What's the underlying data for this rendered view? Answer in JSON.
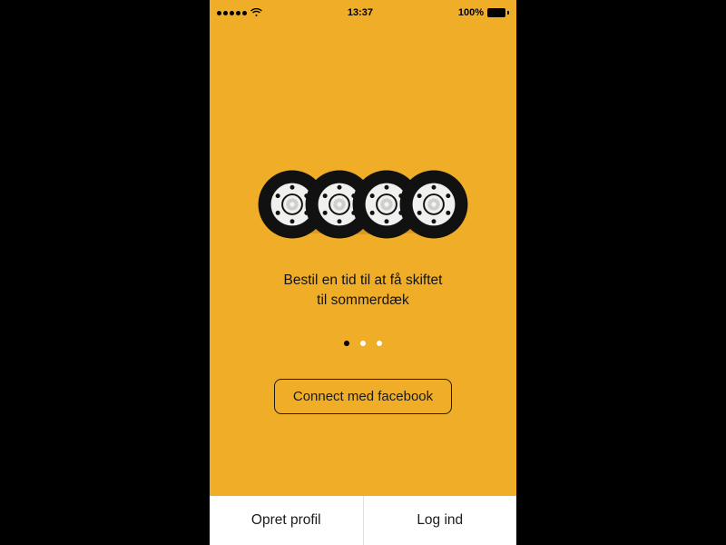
{
  "status": {
    "time": "13:37",
    "battery_text": "100%"
  },
  "onboarding": {
    "caption_line1": "Bestil en tid til at få skiftet",
    "caption_line2": "til sommerdæk",
    "page_count": 3,
    "active_page_index": 0
  },
  "buttons": {
    "facebook": "Connect med facebook",
    "create_profile": "Opret profil",
    "login": "Log ind"
  },
  "colors": {
    "background": "#f0ad27",
    "text": "#141414",
    "shadow": "#da9a1f",
    "bottom_bg": "#ffffff"
  }
}
